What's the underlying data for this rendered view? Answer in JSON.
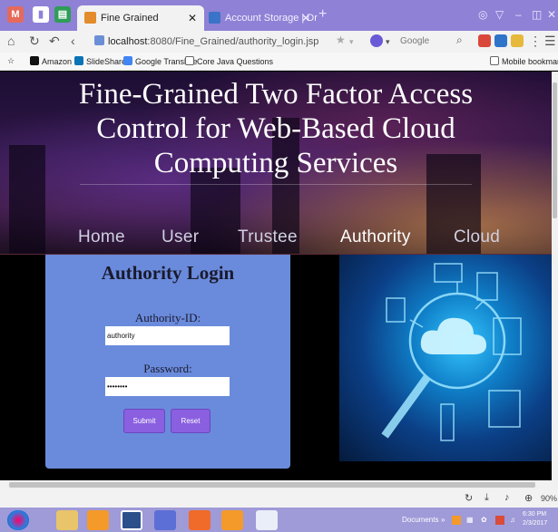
{
  "browser": {
    "tabs": [
      {
        "title": "Fine Grained",
        "active": true
      },
      {
        "title": "Account Storage | DriveHQ",
        "active": false
      }
    ],
    "url": {
      "host": "localhost",
      "path": ":8080/Fine_Grained/authority_login.jsp"
    },
    "search_engine": "Google",
    "bookmarks": [
      "Amazon",
      "SlideShare",
      "Google Translate",
      "Core Java Questions"
    ],
    "mobile_bookmarks": "Mobile bookmarks",
    "zoom": "90%"
  },
  "site": {
    "title_line1": "Fine-Grained Two Factor Access",
    "title_line2": "Control for Web-Based Cloud",
    "title_line3": "Computing Services",
    "nav": [
      "Home",
      "User",
      "Trustee",
      "Authority",
      "Cloud"
    ],
    "active_nav": "Authority"
  },
  "login": {
    "heading": "Authority Login",
    "id_label": "Authority-ID:",
    "id_value": "authority",
    "password_label": "Password:",
    "password_value": "••••••••",
    "submit": "Submit",
    "reset": "Reset"
  },
  "taskbar": {
    "documents": "Documents",
    "time": "6:30 PM",
    "date": "2/3/2017"
  },
  "colors": {
    "tab_bar": "#8f81d6",
    "login_panel": "#6a8bdc",
    "buttons": "#8a5fe0",
    "taskbar": "#9f9ad8"
  }
}
